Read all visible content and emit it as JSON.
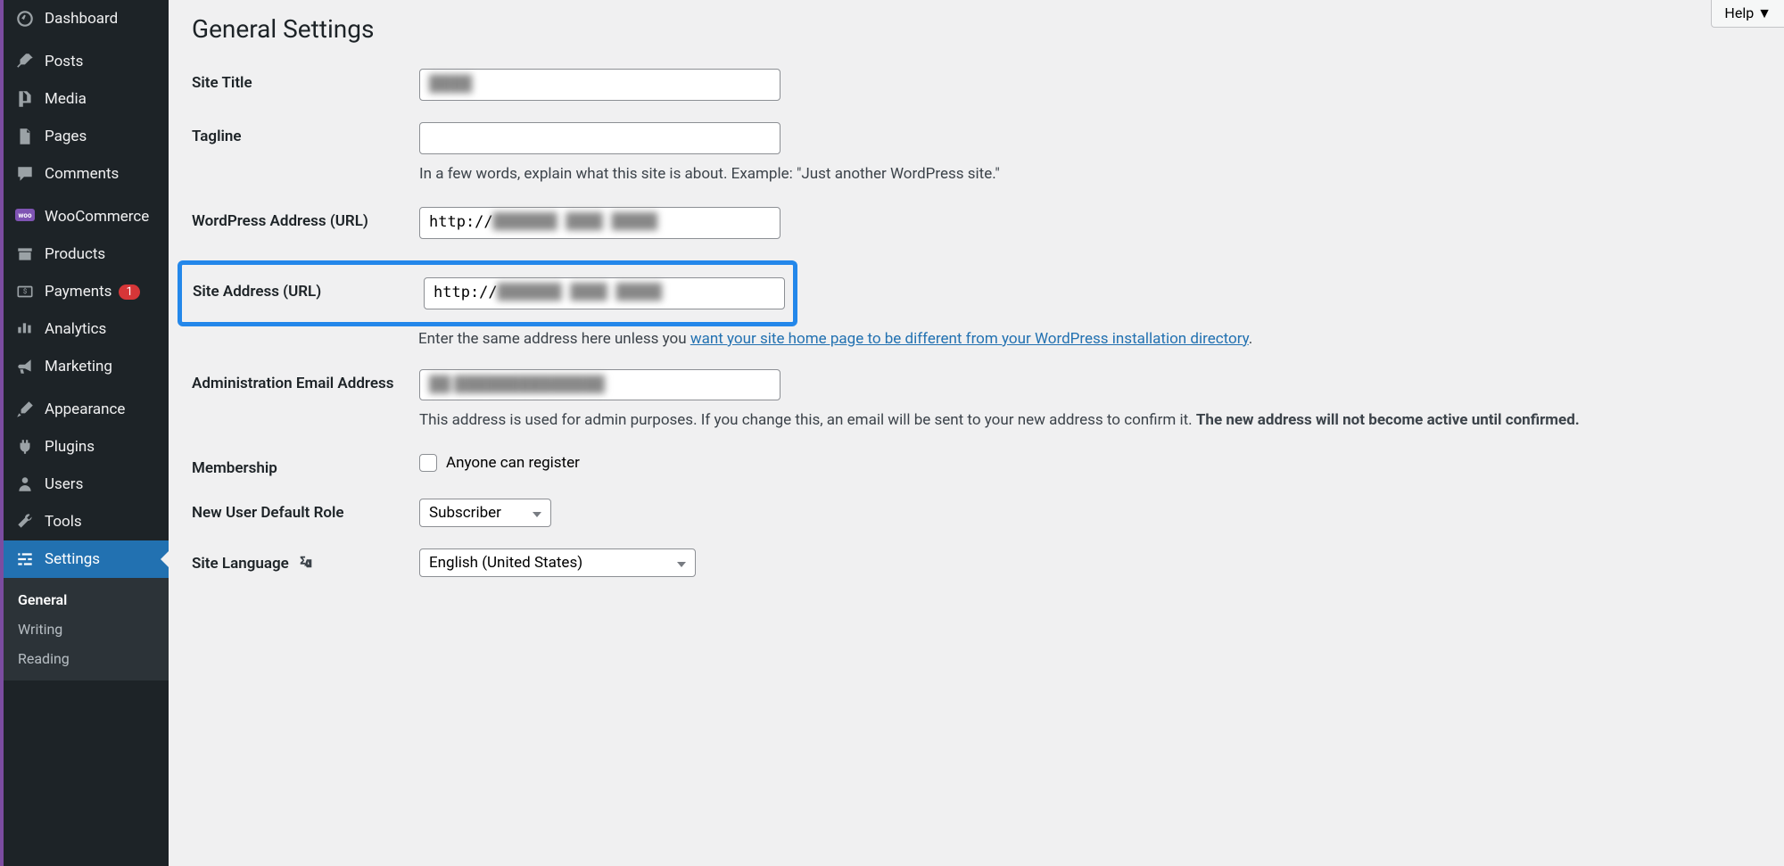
{
  "sidebar": {
    "items": [
      {
        "label": "Dashboard"
      },
      {
        "label": "Posts"
      },
      {
        "label": "Media"
      },
      {
        "label": "Pages"
      },
      {
        "label": "Comments"
      },
      {
        "label": "WooCommerce"
      },
      {
        "label": "Products"
      },
      {
        "label": "Payments",
        "badge": "1"
      },
      {
        "label": "Analytics"
      },
      {
        "label": "Marketing"
      },
      {
        "label": "Appearance"
      },
      {
        "label": "Plugins"
      },
      {
        "label": "Users"
      },
      {
        "label": "Tools"
      },
      {
        "label": "Settings"
      }
    ],
    "submenu": [
      {
        "label": "General"
      },
      {
        "label": "Writing"
      },
      {
        "label": "Reading"
      }
    ]
  },
  "header": {
    "help": "Help ▼"
  },
  "page": {
    "title": "General Settings",
    "site_title_label": "Site Title",
    "site_title_value": "████",
    "tagline_label": "Tagline",
    "tagline_desc": "In a few words, explain what this site is about. Example: \"Just another WordPress site.\"",
    "wp_address_label": "WordPress Address (URL)",
    "wp_address_value": "http://███████ ████ █████",
    "site_address_label": "Site Address (URL)",
    "site_address_value": "http://███████ ████ █████",
    "site_address_desc_prefix": "Enter the same address here unless you ",
    "site_address_link": "want your site home page to be different from your WordPress installation directory",
    "site_address_desc_suffix": ".",
    "admin_email_label": "Administration Email Address",
    "admin_email_value": "██ ██████████████",
    "admin_email_desc1": "This address is used for admin purposes. If you change this, an email will be sent to your new address to confirm it. ",
    "admin_email_desc2": "The new address will not become active until confirmed.",
    "membership_label": "Membership",
    "membership_option": "Anyone can register",
    "default_role_label": "New User Default Role",
    "default_role_value": "Subscriber",
    "language_label": "Site Language",
    "language_value": "English (United States)"
  }
}
